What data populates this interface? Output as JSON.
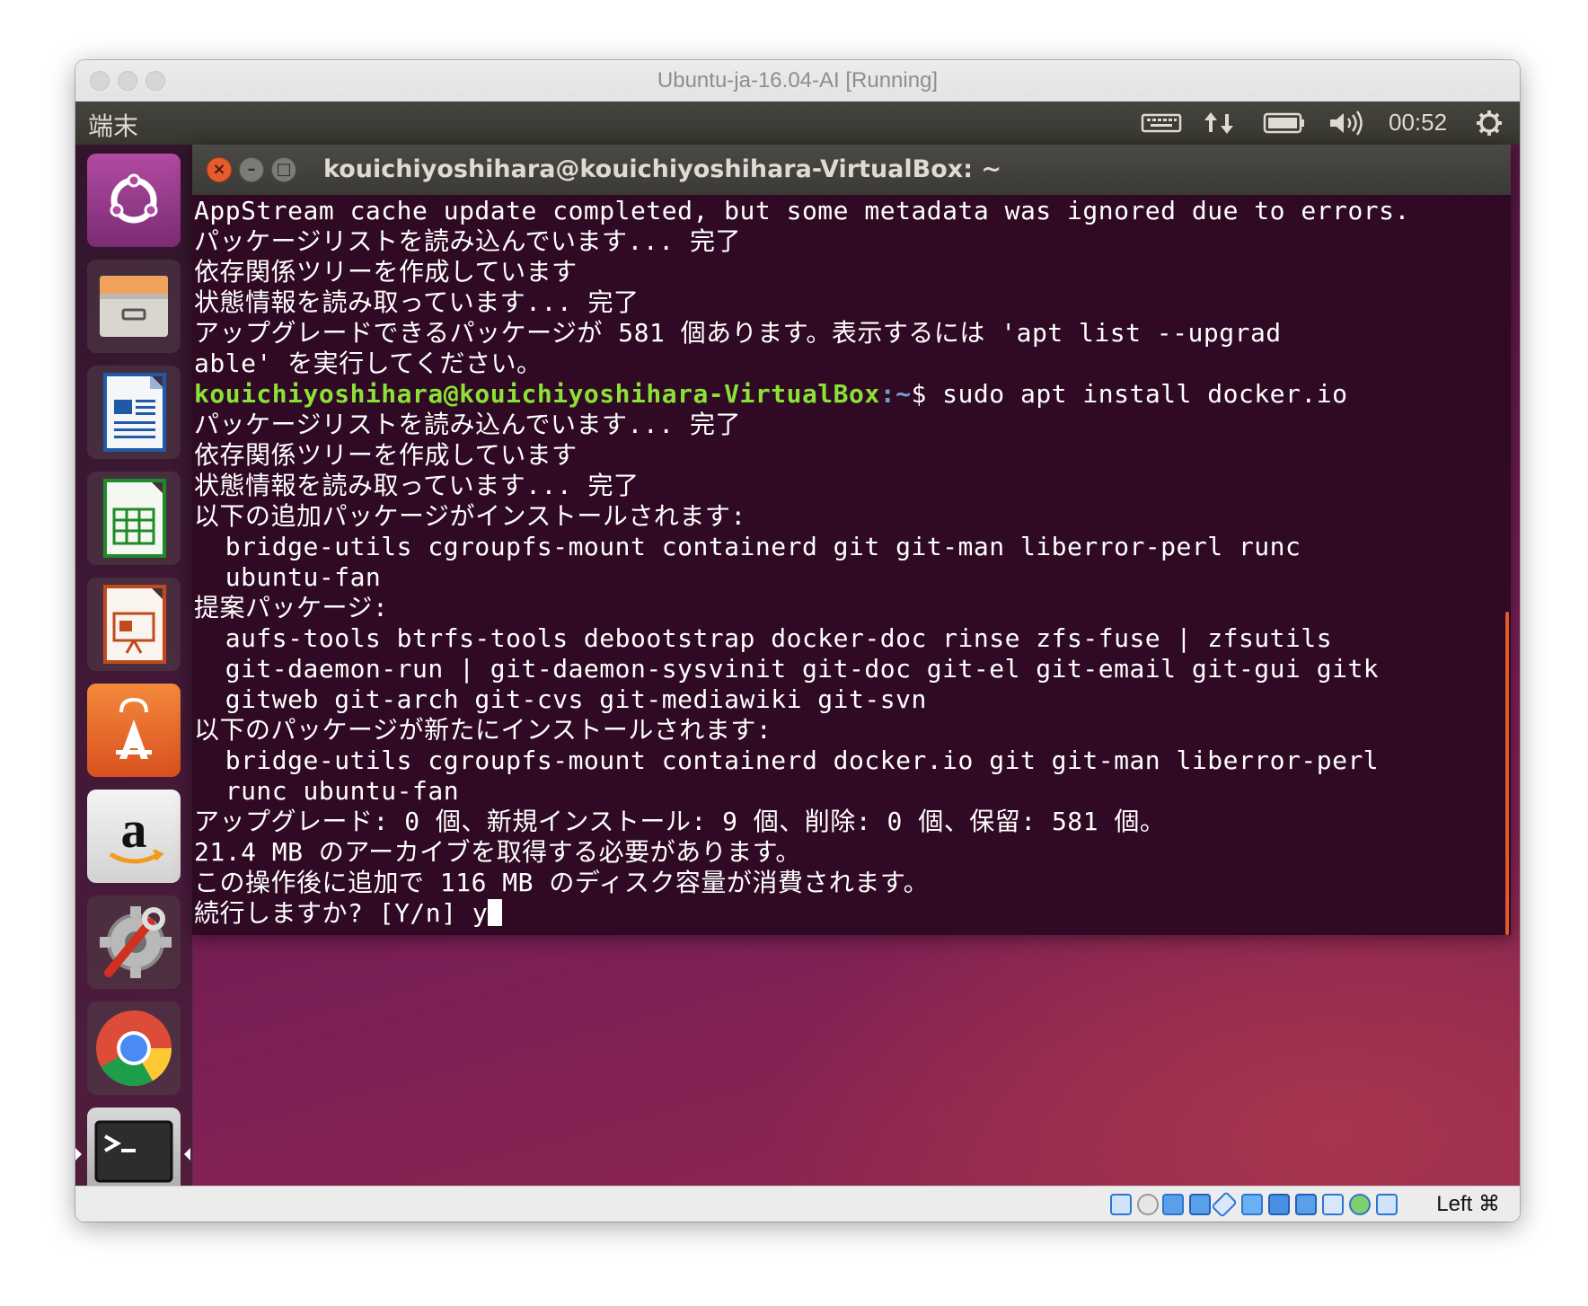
{
  "host_window": {
    "title": "Ubuntu-ja-16.04-AI [Running]"
  },
  "top_panel": {
    "app_name": "端末",
    "clock": "00:52",
    "indicators": [
      "keyboard-icon",
      "network-icon",
      "battery-icon",
      "volume-icon",
      "power-gear-icon"
    ]
  },
  "launcher": {
    "items": [
      "ubuntu-dash-icon",
      "files-icon",
      "writer-icon",
      "calc-icon",
      "impress-icon",
      "software-center-icon",
      "amazon-icon",
      "system-settings-icon",
      "chrome-icon",
      "terminal-icon"
    ]
  },
  "terminal": {
    "title": "kouichiyoshihara@kouichiyoshihara-VirtualBox: ~",
    "lines": [
      "AppStream cache update completed, but some metadata was ignored due to errors.",
      "パッケージリストを読み込んでいます... 完了",
      "依存関係ツリーを作成しています",
      "状態情報を読み取っています... 完了",
      "アップグレードできるパッケージが 581 個あります。表示するには 'apt list --upgrad",
      "able' を実行してください。"
    ],
    "prompt": {
      "user_host": "kouichiyoshihara@kouichiyoshihara-VirtualBox",
      "path": ":~",
      "symbol": "$ ",
      "command": "sudo apt install docker.io"
    },
    "lines_after": [
      "パッケージリストを読み込んでいます... 完了",
      "依存関係ツリーを作成しています",
      "状態情報を読み取っています... 完了",
      "以下の追加パッケージがインストールされます:",
      "  bridge-utils cgroupfs-mount containerd git git-man liberror-perl runc",
      "  ubuntu-fan",
      "提案パッケージ:",
      "  aufs-tools btrfs-tools debootstrap docker-doc rinse zfs-fuse | zfsutils",
      "  git-daemon-run | git-daemon-sysvinit git-doc git-el git-email git-gui gitk",
      "  gitweb git-arch git-cvs git-mediawiki git-svn",
      "以下のパッケージが新たにインストールされます:",
      "  bridge-utils cgroupfs-mount containerd docker.io git git-man liberror-perl",
      "  runc ubuntu-fan",
      "アップグレード: 0 個、新規インストール: 9 個、削除: 0 個、保留: 581 個。",
      "21.4 MB のアーカイブを取得する必要があります。",
      "この操作後に追加で 116 MB のディスク容量が消費されます。"
    ],
    "final_prompt": "続行しますか? [Y/n] y"
  },
  "status_bar": {
    "host_key": "Left ⌘",
    "icons": [
      "hard-disk-icon",
      "optical-drive-icon",
      "audio-icon",
      "network-adapter-icon",
      "usb-icon",
      "shared-folders-icon",
      "display-icon",
      "video-capture-icon",
      "cpu-icon",
      "mouse-integration-icon",
      "keyboard-capture-icon"
    ]
  }
}
